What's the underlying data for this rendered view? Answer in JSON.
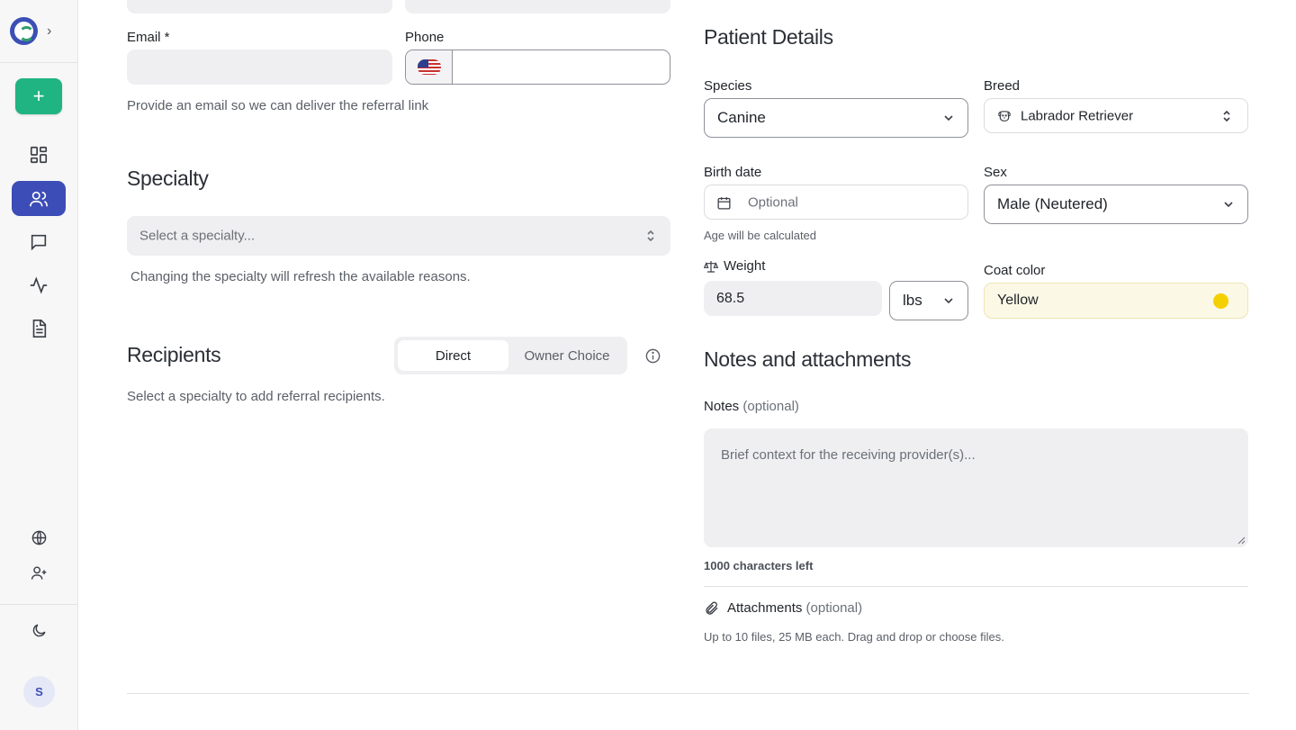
{
  "sidebar": {
    "new_label": "+",
    "avatar_initial": "S",
    "icons": [
      "dashboard-icon",
      "users-icon",
      "chat-icon",
      "activity-icon",
      "document-icon",
      "globe-icon",
      "user-plus-icon",
      "moon-icon"
    ]
  },
  "owner": {
    "email_label": "Email *",
    "email_value": "",
    "phone_label": "Phone",
    "phone_value": "",
    "email_help": "Provide an email so we can deliver the referral link"
  },
  "specialty": {
    "heading": "Specialty",
    "placeholder": "Select a specialty...",
    "help": "Changing the specialty will refresh the available reasons."
  },
  "recipients": {
    "heading": "Recipients",
    "toggle_direct": "Direct",
    "toggle_owner_choice": "Owner Choice",
    "help": "Select a specialty to add referral recipients."
  },
  "patient": {
    "heading": "Patient Details",
    "species_label": "Species",
    "species_value": "Canine",
    "breed_label": "Breed",
    "breed_value": "Labrador Retriever",
    "birthdate_label": "Birth date",
    "birthdate_placeholder": "Optional",
    "birthdate_help": "Age will be calculated",
    "sex_label": "Sex",
    "sex_value": "Male (Neutered)",
    "weight_label": "Weight",
    "weight_value": "68.5",
    "weight_unit": "lbs",
    "coat_label": "Coat color",
    "coat_value": "Yellow",
    "coat_swatch": "#f5d000"
  },
  "notes": {
    "heading": "Notes and attachments",
    "notes_label": "Notes",
    "optional": "(optional)",
    "notes_placeholder": "Brief context for the receiving provider(s)...",
    "chars_left": "1000 characters left",
    "attachments_label": "Attachments",
    "attachments_help": "Up to 10 files, 25 MB each. Drag and drop or choose files."
  },
  "colors": {
    "accent": "#3d4db7",
    "new_button": "#20b482"
  }
}
